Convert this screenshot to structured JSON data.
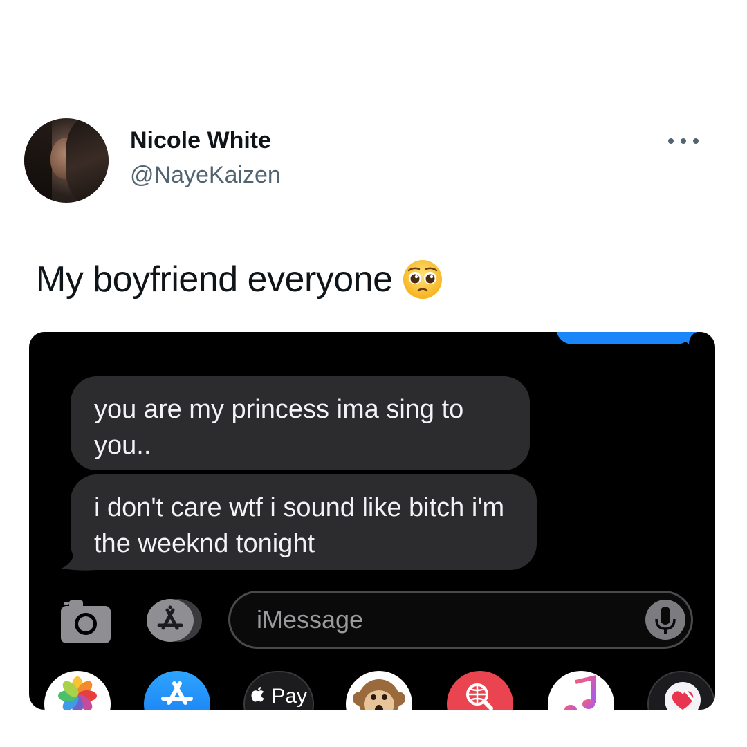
{
  "tweet": {
    "display_name": "Nicole White",
    "handle": "@NayeKaizen",
    "text": "My boyfriend everyone",
    "emoji_icon": "pleading-face-icon"
  },
  "screenshot": {
    "messages": [
      {
        "text": "you are my princess ima sing to you.."
      },
      {
        "text": "i don't care wtf i sound like bitch i'm the weeknd tonight"
      }
    ],
    "input": {
      "placeholder": "iMessage"
    },
    "drawer": {
      "pay_label": " Pay",
      "apps": [
        "photos-icon",
        "app-store-icon",
        "apple-pay-icon",
        "animoji-icon",
        "web-search-icon",
        "music-icon",
        "digital-touch-icon"
      ]
    }
  },
  "colors": {
    "sent_bubble": "#1b86f9",
    "received_bubble": "#2c2c2e",
    "card_background": "#000000",
    "handle_gray": "#536471"
  }
}
